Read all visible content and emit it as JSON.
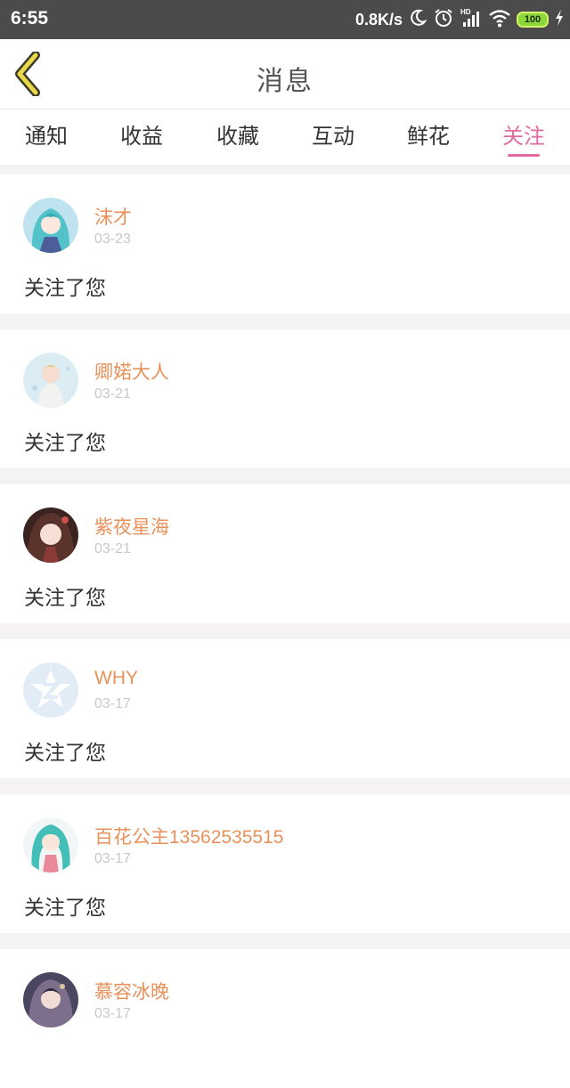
{
  "status_bar": {
    "time": "6:55",
    "net_speed": "0.8K/s",
    "battery": "100",
    "network_label": "HD",
    "icons": [
      "moon-icon",
      "alarm-icon",
      "signal-icon",
      "wifi-icon",
      "battery-icon",
      "charging-icon"
    ]
  },
  "header": {
    "title": "消息",
    "back_icon": "chevron-left-icon",
    "accent": "#e16aa3"
  },
  "tabs": [
    {
      "label": "通知",
      "active": false
    },
    {
      "label": "收益",
      "active": false
    },
    {
      "label": "收藏",
      "active": false
    },
    {
      "label": "互动",
      "active": false
    },
    {
      "label": "鲜花",
      "active": false
    },
    {
      "label": "关注",
      "active": true
    }
  ],
  "notifications": [
    {
      "name": "沫才",
      "date": "03-23",
      "message": "关注了您"
    },
    {
      "name": "卿婼大人",
      "date": "03-21",
      "message": "关注了您"
    },
    {
      "name": "紫夜星海",
      "date": "03-21",
      "message": "关注了您"
    },
    {
      "name": "WHY",
      "date": "03-17",
      "message": "关注了您"
    },
    {
      "name": "百花公主13562535515",
      "date": "03-17",
      "message": "关注了您"
    },
    {
      "name": "慕容冰晚",
      "date": "03-17",
      "message": ""
    }
  ]
}
